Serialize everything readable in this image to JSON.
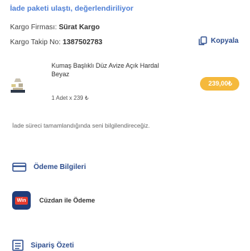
{
  "order": {
    "status_text": "İade paketi ulaştı, değerlendiriliyor",
    "carrier_label": "Kargo Firması: ",
    "carrier_value": "Sürat Kargo",
    "tracking_label": "Kargo Takip No: ",
    "tracking_value": "1387502783",
    "copy_label": "Kopyala"
  },
  "product": {
    "name": "Kumaş Başlıklı Düz Avize Açık Hardal Beyaz",
    "price": "239,00₺",
    "quantity": "1 Adet x 239 ₺"
  },
  "note": "İade süreci tamamlandığında seni bilgilendireceğiz.",
  "payment": {
    "heading": "Ödeme Bilgileri",
    "method_badge": "Win",
    "method_label": "Cüzdan ile Ödeme"
  },
  "summary": {
    "heading": "Sipariş Özeti"
  },
  "colors": {
    "accent": "#2f4f8f",
    "status": "#4e7fd6",
    "price_badge": "#f5b93c"
  }
}
